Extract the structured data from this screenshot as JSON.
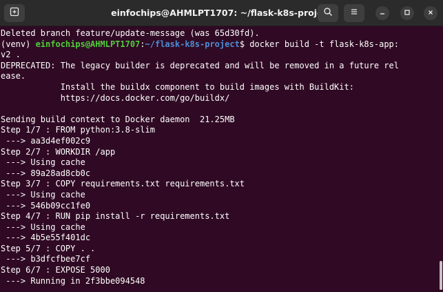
{
  "window": {
    "title": "einfochips@AHMLPT1707: ~/flask-k8s-project"
  },
  "titlebar": {
    "icons": [
      "new-tab-icon",
      "search-icon",
      "hamburger-menu-icon",
      "minimize-icon",
      "maximize-icon",
      "close-icon"
    ]
  },
  "colors": {
    "background": "#300a24",
    "titlebar": "#2b2b2b",
    "text": "#ffffff",
    "prompt_user": "#4fcf3a",
    "prompt_path": "#4d8ed6"
  },
  "terminal": {
    "line1": "Deleted branch feature/update-message (was 65d30fd).",
    "prompt_prefix": "(venv) ",
    "prompt_user": "einfochips@AHMLPT1707",
    "prompt_colon": ":",
    "prompt_path": "~/flask-k8s-project",
    "prompt_symbol": "$ ",
    "command_part1": "docker build -t flask-k8s-app:",
    "command_part2": "v2 .",
    "deprecated1": "DEPRECATED: The legacy builder is deprecated and will be removed in a future rel",
    "deprecated2": "ease.",
    "install1": "            Install the buildx component to build images with BuildKit:",
    "install2": "            https://docs.docker.com/go/buildx/",
    "blank": "",
    "sending": "Sending build context to Docker daemon  21.25MB",
    "step1": "Step 1/7 : FROM python:3.8-slim",
    "step1_id": " ---> aa3d4ef002c9",
    "step2": "Step 2/7 : WORKDIR /app",
    "step2_cache": " ---> Using cache",
    "step2_id": " ---> 89a28ad8cb0c",
    "step3": "Step 3/7 : COPY requirements.txt requirements.txt",
    "step3_cache": " ---> Using cache",
    "step3_id": " ---> 546b09cc1fe0",
    "step4": "Step 4/7 : RUN pip install -r requirements.txt",
    "step4_cache": " ---> Using cache",
    "step4_id": " ---> 4b5e55f401dc",
    "step5": "Step 5/7 : COPY . .",
    "step5_id": " ---> b3dfcfbee7cf",
    "step6": "Step 6/7 : EXPOSE 5000",
    "step6_running": " ---> Running in 2f3bbe094548"
  }
}
